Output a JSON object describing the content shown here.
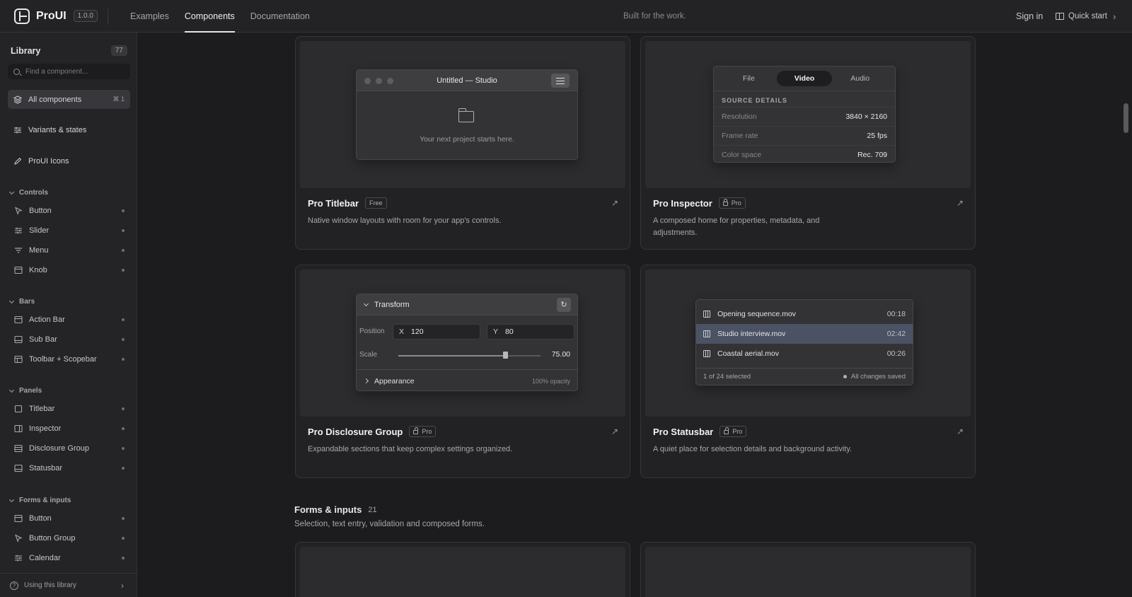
{
  "header": {
    "brand": "ProUI",
    "version": "1.0.0",
    "nav": [
      {
        "label": "Examples",
        "active": false
      },
      {
        "label": "Components",
        "active": true
      },
      {
        "label": "Documentation",
        "active": false
      }
    ],
    "tagline": "Built for the work.",
    "sign_in": "Sign in",
    "quick_start": "Quick start"
  },
  "sidebar": {
    "title": "Library",
    "count": "77",
    "search_placeholder": "Find a component...",
    "top_items": [
      {
        "label": "All components",
        "shortcut": "⌘ 1",
        "icon": "layers-icon"
      },
      {
        "label": "Variants & states",
        "icon": "sliders-icon"
      },
      {
        "label": "ProUI Icons",
        "icon": "pen-icon"
      }
    ],
    "groups": [
      {
        "title": "Controls",
        "items": [
          {
            "label": "Button",
            "icon": "cursor-icon"
          },
          {
            "label": "Slider",
            "icon": "sliders-icon"
          },
          {
            "label": "Menu",
            "icon": "filter-icon"
          },
          {
            "label": "Knob",
            "icon": "panel-icon"
          }
        ]
      },
      {
        "title": "Bars",
        "items": [
          {
            "label": "Action Bar",
            "icon": "panel-icon"
          },
          {
            "label": "Sub Bar",
            "icon": "panel-icon"
          },
          {
            "label": "Toolbar + Scopebar",
            "icon": "layout-icon"
          }
        ]
      },
      {
        "title": "Panels",
        "items": [
          {
            "label": "Titlebar",
            "icon": "square-icon"
          },
          {
            "label": "Inspector",
            "icon": "sidebar-icon"
          },
          {
            "label": "Disclosure Group",
            "icon": "list-icon"
          },
          {
            "label": "Statusbar",
            "icon": "panel-icon"
          }
        ]
      },
      {
        "title": "Forms & inputs",
        "items": [
          {
            "label": "Button",
            "icon": "panel-icon"
          },
          {
            "label": "Button Group",
            "icon": "cursor-icon"
          },
          {
            "label": "Calendar",
            "icon": "sliders-icon"
          }
        ]
      }
    ],
    "footer": "Using this library"
  },
  "cards": {
    "titlebar": {
      "name": "Pro Titlebar",
      "badge": "Free",
      "desc": "Native window layouts with room for your app's controls.",
      "window_title": "Untitled — Studio",
      "empty_message": "Your next project starts here."
    },
    "inspector": {
      "name": "Pro Inspector",
      "badge": "Pro",
      "desc": "A composed home for properties, metadata, and adjustments.",
      "segments": [
        {
          "label": "File",
          "active": false
        },
        {
          "label": "Video",
          "active": true
        },
        {
          "label": "Audio",
          "active": false
        }
      ],
      "section": "SOURCE DETAILS",
      "rows": [
        {
          "key": "Resolution",
          "value": "3840 × 2160"
        },
        {
          "key": "Frame rate",
          "value": "25 fps"
        },
        {
          "key": "Color space",
          "value": "Rec. 709"
        }
      ]
    },
    "disclosure": {
      "name": "Pro Disclosure Group",
      "badge": "Pro",
      "desc": "Expandable sections that keep complex settings organized.",
      "header": "Transform",
      "position_label": "Position",
      "x_label": "X",
      "x_value": "120",
      "y_label": "Y",
      "y_value": "80",
      "scale_label": "Scale",
      "scale_value": "75.00",
      "scale_fraction": 0.75,
      "collapsed": "Appearance",
      "collapsed_meta": "100% opacity"
    },
    "statusbar": {
      "name": "Pro Statusbar",
      "badge": "Pro",
      "desc": "A quiet place for selection details and background activity.",
      "files": [
        {
          "name": "Opening sequence.mov",
          "duration": "00:18",
          "selected": false
        },
        {
          "name": "Studio interview.mov",
          "duration": "02:42",
          "selected": true
        },
        {
          "name": "Coastal aerial.mov",
          "duration": "00:26",
          "selected": false
        }
      ],
      "selection": "1 of 24 selected",
      "status": "All changes saved"
    }
  },
  "section": {
    "title": "Forms & inputs",
    "count": "21",
    "subtitle": "Selection, text entry, validation and composed forms."
  }
}
